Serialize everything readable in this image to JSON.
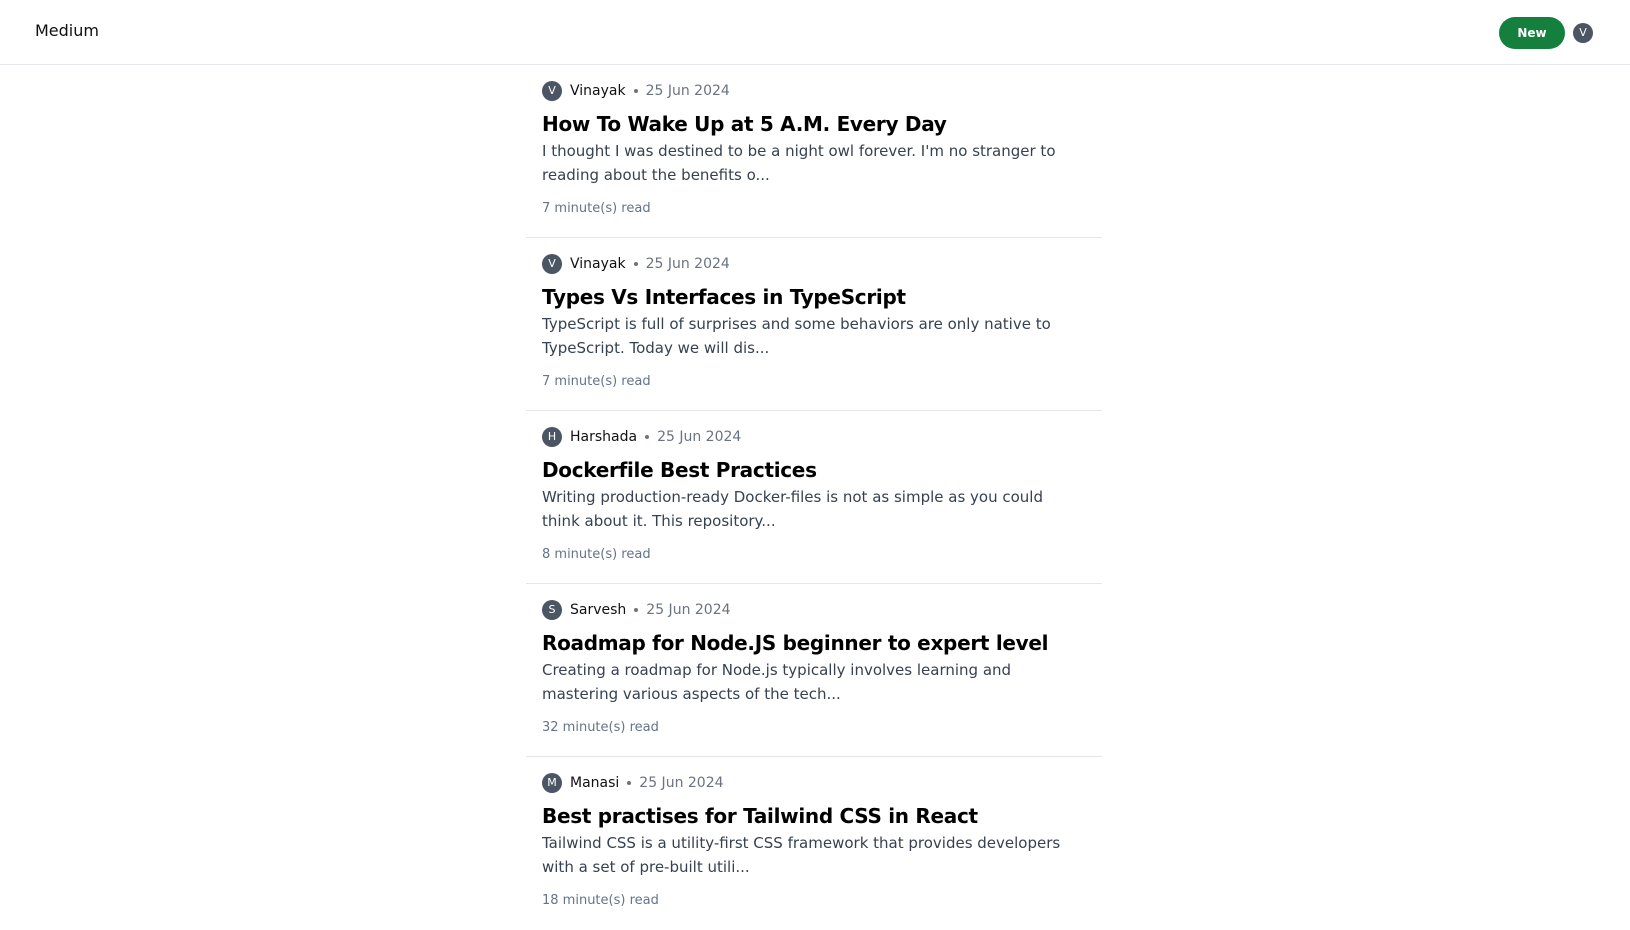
{
  "header": {
    "brand": "Medium",
    "new_button_label": "New",
    "user_initial": "V"
  },
  "posts": [
    {
      "initial": "V",
      "author": "Vinayak",
      "date": "25 Jun 2024",
      "title": "How To Wake Up at 5 A.M. Every Day",
      "excerpt": "I thought I was destined to be a night owl forever. I'm no stranger to reading about the benefits o...",
      "read_time": "7 minute(s) read"
    },
    {
      "initial": "V",
      "author": "Vinayak",
      "date": "25 Jun 2024",
      "title": "Types Vs Interfaces in TypeScript",
      "excerpt": "TypeScript is full of surprises and some behaviors are only native to TypeScript. Today we will dis...",
      "read_time": "7 minute(s) read"
    },
    {
      "initial": "H",
      "author": "Harshada",
      "date": "25 Jun 2024",
      "title": "Dockerfile Best Practices",
      "excerpt": "Writing production-ready Docker-files is not as simple as you could think about it. This repository...",
      "read_time": "8 minute(s) read"
    },
    {
      "initial": "S",
      "author": "Sarvesh",
      "date": "25 Jun 2024",
      "title": "Roadmap for Node.JS beginner to expert level",
      "excerpt": "Creating a roadmap for Node.js typically involves learning and mastering various aspects of the tech...",
      "read_time": "32 minute(s) read"
    },
    {
      "initial": "M",
      "author": "Manasi",
      "date": "25 Jun 2024",
      "title": "Best practises for Tailwind CSS in React",
      "excerpt": "Tailwind CSS is a utility-first CSS framework that provides developers with a set of pre-built utili...",
      "read_time": "18 minute(s) read"
    }
  ],
  "colors": {
    "accent_green": "#15803d",
    "avatar_gray": "#4b5563",
    "divider": "#e5e7eb"
  }
}
